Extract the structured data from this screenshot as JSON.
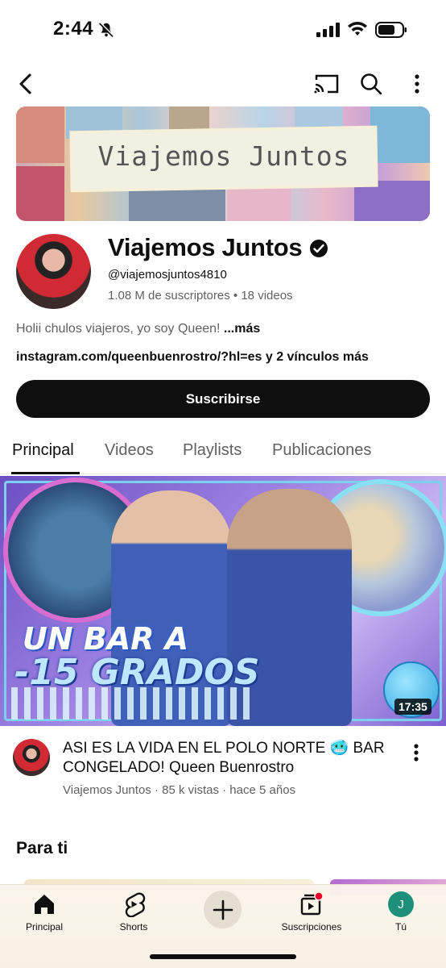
{
  "status_bar": {
    "time": "2:44",
    "icons": [
      "bell-off-icon",
      "signal-icon",
      "wifi-icon",
      "battery-icon"
    ]
  },
  "top_nav": {
    "icons": [
      "back-icon",
      "cast-icon",
      "search-icon",
      "more-vert-icon"
    ]
  },
  "banner": {
    "title": "Viajemos Juntos"
  },
  "channel": {
    "name": "Viajemos Juntos",
    "verified_icon": "verified-check-icon",
    "handle": "@viajemosjuntos4810",
    "subscribers": "1.08 M de suscriptores",
    "separator": " • ",
    "video_count": "18 videos",
    "description": "Holii chulos viajeros, yo soy Queen!",
    "description_more": " ...más",
    "links": "instagram.com/queenbuenrostro/?hl=es y 2 vínculos más",
    "subscribe_label": "Suscribirse"
  },
  "tabs": [
    {
      "label": "Principal",
      "active": true
    },
    {
      "label": "Videos",
      "active": false
    },
    {
      "label": "Playlists",
      "active": false
    },
    {
      "label": "Publicaciones",
      "active": false
    }
  ],
  "featured_video": {
    "thumbnail_text_line1": "UN BAR A",
    "thumbnail_text_line2": "-15 GRADOS",
    "duration": "17:35",
    "title": "ASI ES LA VIDA EN EL POLO NORTE 🥶 BAR CONGELADO! Queen Buenrostro",
    "meta": "Viajemos Juntos · 85 k vistas · hace 5 años"
  },
  "section_title": "Para ti",
  "bottom_nav": {
    "items": [
      {
        "label": "Principal",
        "icon": "home-icon"
      },
      {
        "label": "Shorts",
        "icon": "shorts-icon"
      },
      {
        "label": "",
        "icon": "create-plus-icon"
      },
      {
        "label": "Suscripciones",
        "icon": "subscriptions-icon"
      },
      {
        "label": "Tú",
        "icon": "you-avatar",
        "avatar_letter": "J"
      }
    ]
  },
  "colors": {
    "text_primary": "#0f0f0f",
    "text_secondary": "#606060",
    "subscribe_bg": "#0f0f0f",
    "notification_red": "#e8002b",
    "you_avatar_bg": "#1e8f7a"
  }
}
